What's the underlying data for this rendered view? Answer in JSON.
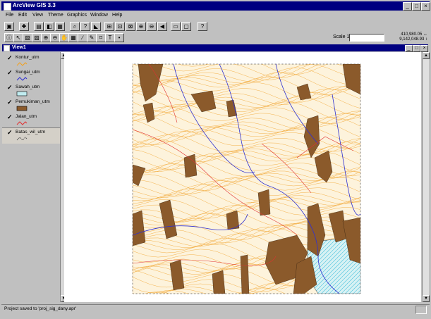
{
  "window": {
    "title": "ArcView GIS 3.3",
    "min": "_",
    "max": "□",
    "close": "×"
  },
  "menu": [
    "File",
    "Edit",
    "View",
    "Theme",
    "Graphics",
    "Window",
    "Help"
  ],
  "toolbar1": [
    "save-icon",
    "add-theme-icon",
    "theme-props-icon",
    "edit-legend-icon",
    "open-table-icon",
    "find-icon",
    "query-icon",
    "locate-icon",
    "zoom-full-icon",
    "zoom-active-icon",
    "zoom-selected-icon",
    "zoom-in-icon",
    "zoom-out-icon",
    "zoom-previous-icon",
    "select-feature-icon",
    "clear-select-icon",
    "help-icon"
  ],
  "toolbar1_glyphs": [
    "▣",
    "✚",
    "▤",
    "◧",
    "▦",
    "⌕",
    "?",
    "◣",
    "⊞",
    "⊡",
    "⊠",
    "⊕",
    "⊖",
    "◀",
    "▭",
    "▢",
    "?"
  ],
  "toolbar2_glyphs": [
    "ⓘ",
    "↖",
    "▧",
    "▨",
    "⊕",
    "⊖",
    "✋",
    "▦",
    "∕",
    "✎",
    "⌑",
    "T",
    "•"
  ],
  "scale": {
    "label": "Scale 1:",
    "value": ""
  },
  "coords": {
    "x": "410,980.05 ↔",
    "y": "9,142,048.93 ↕"
  },
  "view": {
    "title": "View1"
  },
  "themes": [
    {
      "name": "Kontur_utm",
      "color": "#f0a020"
    },
    {
      "name": "Sungai_utm",
      "color": "#3030d0"
    },
    {
      "name": "Sawah_utm",
      "color": "#c0ecf0"
    },
    {
      "name": "Pemukiman_utm",
      "color": "#8b5a2b"
    },
    {
      "name": "Jalan_utm",
      "color": "#e03030"
    },
    {
      "name": "Batas_wil_utm",
      "color": "#404040"
    }
  ],
  "status": {
    "text": "Project saved to 'proj_sig_dany.apr'"
  }
}
